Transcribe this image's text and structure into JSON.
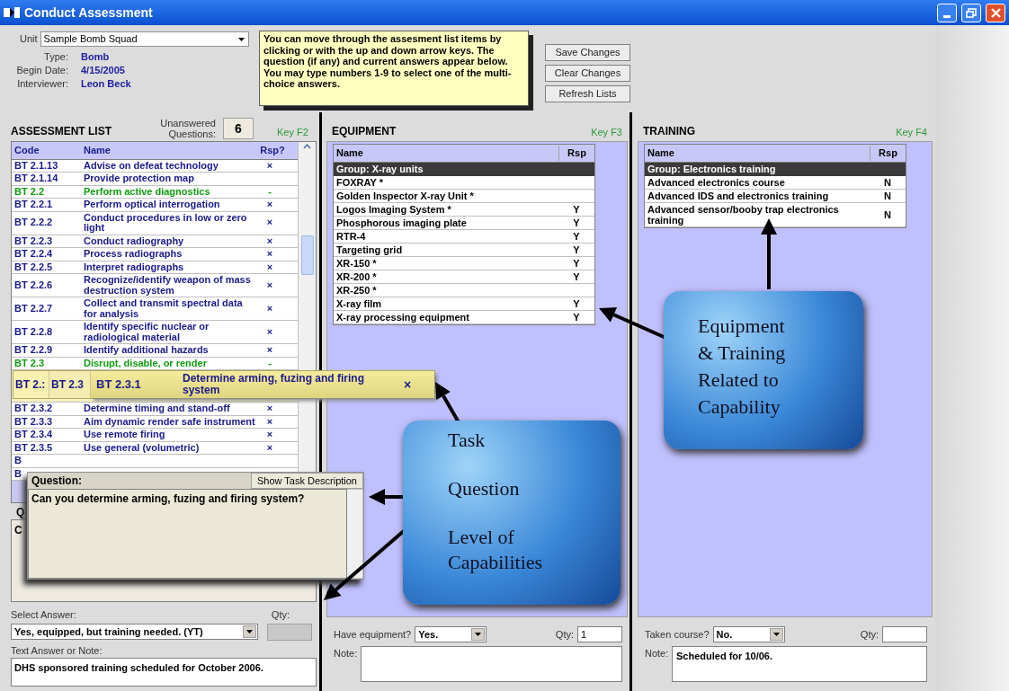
{
  "window": {
    "title": "Conduct Assessment"
  },
  "unit": {
    "label": "Unit",
    "value": "Sample Bomb Squad"
  },
  "info": [
    {
      "label": "Type:",
      "value": "Bomb"
    },
    {
      "label": "Begin Date:",
      "value": "4/15/2005"
    },
    {
      "label": "Interviewer:",
      "value": "Leon Beck"
    }
  ],
  "tip": "You can move through the assesment list items by clicking or with the up and down arrow keys. The question (if any) and current answers appear below. You may type numbers 1-9 to select one of the multi-choice answers.",
  "buttons": [
    "Save Changes",
    "Clear Changes",
    "Refresh Lists"
  ],
  "assessment": {
    "title": "ASSESSMENT LIST",
    "unanswered_label": "Unanswered Questions:",
    "unanswered_count": "6",
    "key": "Key F2",
    "columns": [
      "Code",
      "Name",
      "Rsp?"
    ],
    "rows": [
      {
        "kind": "task",
        "code": "BT 2.1.13",
        "name": "Advise on defeat technology",
        "rsp": "×"
      },
      {
        "kind": "task",
        "code": "BT 2.1.14",
        "name": "Provide protection map"
      },
      {
        "kind": "group",
        "code": "BT 2.2",
        "name": "Perform active diagnostics",
        "rsp": "-"
      },
      {
        "kind": "task",
        "code": "BT 2.2.1",
        "name": "Perform optical interrogation",
        "rsp": "×"
      },
      {
        "kind": "task",
        "code": "BT 2.2.2",
        "name": "Conduct procedures in low or zero light",
        "rsp": "×"
      },
      {
        "kind": "task",
        "code": "BT 2.2.3",
        "name": "Conduct radiography",
        "rsp": "×"
      },
      {
        "kind": "task",
        "code": "BT 2.2.4",
        "name": "Process radiographs",
        "rsp": "×"
      },
      {
        "kind": "task",
        "code": "BT 2.2.5",
        "name": "Interpret radiographs",
        "rsp": "×"
      },
      {
        "kind": "task",
        "code": "BT 2.2.6",
        "name": "Recognize/identify weapon of mass destruction system",
        "rsp": "×"
      },
      {
        "kind": "task",
        "code": "BT 2.2.7",
        "name": "Collect and transmit spectral data for analysis",
        "rsp": "×"
      },
      {
        "kind": "task",
        "code": "BT 2.2.8",
        "name": "Identify specific nuclear or radiological material",
        "rsp": "×"
      },
      {
        "kind": "task",
        "code": "BT 2.2.9",
        "name": "Identify additional hazards",
        "rsp": "×"
      },
      {
        "kind": "group",
        "code": "BT 2.3",
        "name": "Disrupt, disable, or render",
        "rsp": "-"
      },
      {
        "kind": "covered"
      },
      {
        "kind": "task",
        "code": "BT 2.3.2",
        "name": "Determine timing and stand-off",
        "rsp": "×"
      },
      {
        "kind": "task",
        "code": "BT 2.3.3",
        "name": "Aim dynamic render safe instrument",
        "rsp": "×"
      },
      {
        "kind": "task",
        "code": "BT 2.3.4",
        "name": "Use remote firing",
        "rsp": "×"
      },
      {
        "kind": "task",
        "code": "BT 2.3.5",
        "name": "Use general (volumetric)",
        "rsp": "×"
      },
      {
        "kind": "task",
        "code": "B"
      },
      {
        "kind": "task",
        "code": "B"
      }
    ]
  },
  "question_base": {
    "label": "Q",
    "text": "C"
  },
  "answer": {
    "label": "Select Answer:",
    "value": "Yes, equipped, but training needed. (YT)",
    "qty_label": "Qty:",
    "note_label": "Text Answer or Note:",
    "note": "DHS sponsored training scheduled for October 2006."
  },
  "equipment": {
    "title": "EQUIPMENT",
    "key": "Key F3",
    "columns": [
      "Name",
      "Rsp"
    ],
    "rows": [
      {
        "kind": "group",
        "name": "Group: X-ray units"
      },
      {
        "kind": "item",
        "name": "FOXRAY *"
      },
      {
        "kind": "item",
        "name": "Golden Inspector X-ray Unit *"
      },
      {
        "kind": "item",
        "name": "Logos Imaging System *",
        "rsp": "Y"
      },
      {
        "kind": "item",
        "name": "Phosphorous imaging plate",
        "rsp": "Y"
      },
      {
        "kind": "item",
        "name": "RTR-4",
        "rsp": "Y"
      },
      {
        "kind": "item",
        "name": "Targeting grid",
        "rsp": "Y"
      },
      {
        "kind": "item",
        "name": "XR-150 *",
        "rsp": "Y"
      },
      {
        "kind": "item",
        "name": "XR-200 *",
        "rsp": "Y"
      },
      {
        "kind": "item",
        "name": "XR-250 *"
      },
      {
        "kind": "item",
        "name": "X-ray film",
        "rsp": "Y"
      },
      {
        "kind": "item",
        "name": "X-ray processing equipment",
        "rsp": "Y"
      }
    ],
    "answer_label": "Have equipment?",
    "answer_value": "Yes.",
    "qty_label": "Qty:",
    "qty": "1",
    "note_label": "Note:"
  },
  "training": {
    "title": "TRAINING",
    "key": "Key F4",
    "columns": [
      "Name",
      "Rsp"
    ],
    "rows": [
      {
        "kind": "group",
        "name": "Group: Electronics training"
      },
      {
        "kind": "item",
        "name": "Advanced electronics course",
        "rsp": "N"
      },
      {
        "kind": "item",
        "name": "Advanced IDS and electronics training",
        "rsp": "N"
      },
      {
        "kind": "item",
        "name": "Advanced sensor/booby trap electronics training",
        "rsp": "N"
      }
    ],
    "answer_label": "Taken course?",
    "answer_value": "No.",
    "qty_label": "Qty:",
    "note_label": "Note:",
    "note": "Scheduled for 10/06."
  },
  "tooltip": {
    "ghost_codes": [
      "BT 2.:",
      "BT 2.3"
    ],
    "code": "BT 2.3.1",
    "name": "Determine arming, fuzing and firing system",
    "rsp": "×"
  },
  "question_popup": {
    "label": "Question:",
    "button": "Show Task Description",
    "text": "Can you determine arming, fuzing and firing system?"
  },
  "callouts": [
    {
      "lines": [
        "Task",
        "Question",
        "Level of Capabilities"
      ]
    },
    {
      "lines": [
        "Equipment & Training Related to Capability"
      ]
    }
  ]
}
